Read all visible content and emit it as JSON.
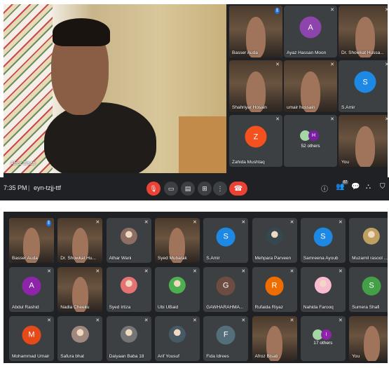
{
  "top": {
    "main_speaker": {
      "name": "Afroz Bisati"
    },
    "tiles": [
      {
        "name": "Basser Auda",
        "kind": "video",
        "active": true
      },
      {
        "name": "Ayaz Hassan Moon",
        "kind": "avatar",
        "letter": "A",
        "color": "#8e44ad"
      },
      {
        "name": "Dr. Showkat Hussa...",
        "kind": "video"
      },
      {
        "name": "Shahriyar Hosain",
        "kind": "video"
      },
      {
        "name": "umair hussain",
        "kind": "video"
      },
      {
        "name": "S.Amir",
        "kind": "avatar",
        "letter": "S",
        "color": "#1e88e5"
      },
      {
        "name": "Zahida Mushtaq",
        "kind": "avatar",
        "letter": "Z",
        "color": "#f4511e"
      },
      {
        "name": "52 others",
        "kind": "others",
        "letter": "H",
        "color": "#7b1fa2"
      },
      {
        "name": "You",
        "kind": "video"
      }
    ]
  },
  "controls": {
    "time": "7:35 PM",
    "separator": "|",
    "meeting_code": "eyn-tzjj-ttf",
    "people_count": "87"
  },
  "bottom": {
    "tiles": [
      {
        "name": "Basser Auda",
        "kind": "video",
        "active": true
      },
      {
        "name": "Dr. Showkat Hu...",
        "kind": "video"
      },
      {
        "name": "Athar Wani",
        "kind": "photo",
        "color": "#8d6e63"
      },
      {
        "name": "Syed Mubarak",
        "kind": "video"
      },
      {
        "name": "S.Amir",
        "kind": "avatar",
        "letter": "S",
        "color": "#1e88e5"
      },
      {
        "name": "Mehpara Parveen",
        "kind": "photo",
        "color": "#37474f"
      },
      {
        "name": "Samreena Ayoub",
        "kind": "avatar",
        "letter": "S",
        "color": "#1e88e5"
      },
      {
        "name": "Muzamil rasool ...",
        "kind": "photo",
        "color": "#c0a060"
      },
      {
        "name": "Abdul Rashid",
        "kind": "avatar",
        "letter": "A",
        "color": "#8e24aa"
      },
      {
        "name": "Nadia Cheeku",
        "kind": "video"
      },
      {
        "name": "Syed Irtiza",
        "kind": "photo",
        "color": "#e57373"
      },
      {
        "name": "Ubi UBaid",
        "kind": "photo",
        "color": "#4caf50"
      },
      {
        "name": "GAWHARAHMA...",
        "kind": "avatar",
        "letter": "G",
        "color": "#6d4c41"
      },
      {
        "name": "Rufaida Riyaz",
        "kind": "avatar",
        "letter": "R",
        "color": "#ef6c00"
      },
      {
        "name": "Nahida Farooq",
        "kind": "photo",
        "color": "#f8bbd0"
      },
      {
        "name": "Sumera Shafi",
        "kind": "avatar",
        "letter": "S",
        "color": "#43a047"
      },
      {
        "name": "Mohammad Umair",
        "kind": "avatar",
        "letter": "M",
        "color": "#e64a19"
      },
      {
        "name": "Safura bhat",
        "kind": "photo",
        "color": "#a1887f"
      },
      {
        "name": "Daiyaan Baba 18",
        "kind": "photo",
        "color": "#757575"
      },
      {
        "name": "Arif Yousuf",
        "kind": "photo",
        "color": "#455a64"
      },
      {
        "name": "Fida Idrees",
        "kind": "avatar",
        "letter": "F",
        "color": "#546e7a"
      },
      {
        "name": "Afroz Bisati",
        "kind": "video"
      },
      {
        "name": "17 others",
        "kind": "others",
        "letter": "I",
        "color": "#8e24aa"
      },
      {
        "name": "You",
        "kind": "video"
      }
    ]
  }
}
